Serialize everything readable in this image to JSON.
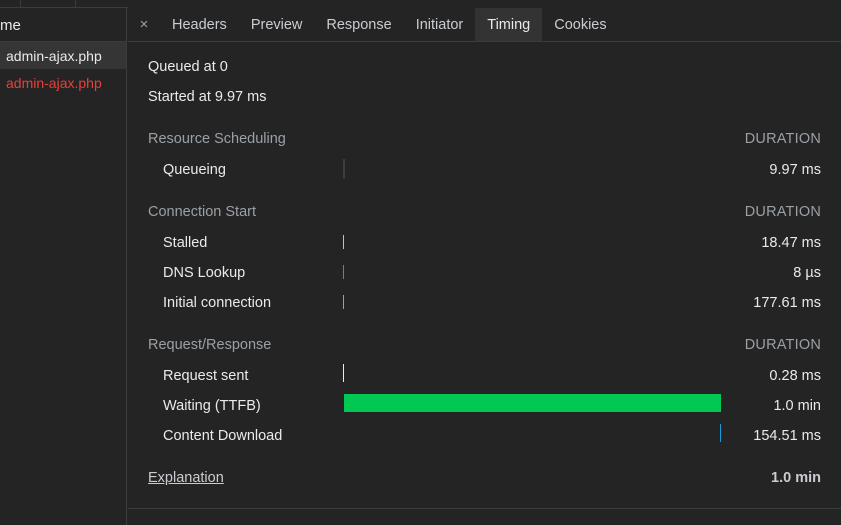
{
  "request_list": {
    "header_label": "me",
    "items": [
      {
        "name": "admin-ajax.php",
        "status": "selected"
      },
      {
        "name": "admin-ajax.php",
        "status": "error"
      }
    ]
  },
  "tabs": {
    "close_label": "×",
    "items": [
      {
        "label": "Headers"
      },
      {
        "label": "Preview"
      },
      {
        "label": "Response"
      },
      {
        "label": "Initiator"
      },
      {
        "label": "Timing"
      },
      {
        "label": "Cookies"
      }
    ],
    "active": "Timing"
  },
  "timing": {
    "queued_at": "Queued at 0",
    "started_at": "Started at 9.97 ms",
    "sections": [
      {
        "title": "Resource Scheduling",
        "duration_label": "DURATION",
        "rows": [
          {
            "label": "Queueing",
            "value": "9.97 ms",
            "color": "#5f6368",
            "start": 0.0,
            "fraction": 0.0
          }
        ]
      },
      {
        "title": "Connection Start",
        "duration_label": "DURATION",
        "rows": [
          {
            "label": "Stalled",
            "value": "18.47 ms",
            "color": "#bdc1c6",
            "start": 0.0,
            "fraction": 0.0
          },
          {
            "label": "DNS Lookup",
            "value": "8 µs",
            "color": "#1a9bd7",
            "start": 0.0,
            "fraction": 0.0
          },
          {
            "label": "Initial connection",
            "value": "177.61 ms",
            "color": "#f28b30",
            "start": 0.0,
            "fraction": 0.0
          }
        ]
      },
      {
        "title": "Request/Response",
        "duration_label": "DURATION",
        "rows": [
          {
            "label": "Request sent",
            "value": "0.28 ms",
            "color": "#e8eaed",
            "start": 0.0,
            "fraction": 0.0
          },
          {
            "label": "Waiting (TTFB)",
            "value": "1.0 min",
            "color": "#00c853",
            "start": 0.003,
            "fraction": 0.997
          },
          {
            "label": "Content Download",
            "value": "154.51 ms",
            "color": "#1a9bd7",
            "start": 0.997,
            "fraction": 0.003
          }
        ]
      }
    ],
    "explanation_label": "Explanation",
    "total": "1.0 min"
  }
}
